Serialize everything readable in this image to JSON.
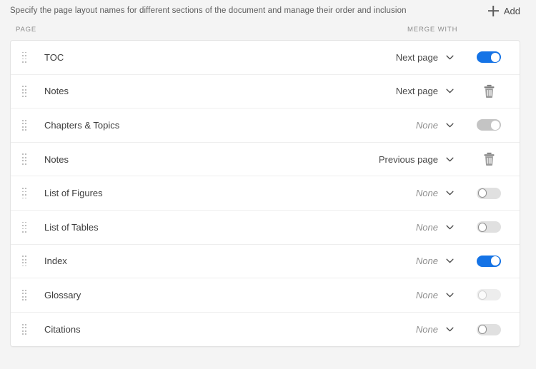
{
  "header": {
    "description": "Specify the page layout names for different sections of the document and manage their order and inclusion",
    "add_label": "Add",
    "add_icon": "plus-icon"
  },
  "table": {
    "columns": {
      "page": "PAGE",
      "merge_with": "MERGE WITH"
    },
    "rows": [
      {
        "name": "TOC",
        "merge_with": "Next page",
        "merge_is_none": false,
        "action": "toggle",
        "toggle_state": "on",
        "drag_handle_icon": "drag-handle-icon",
        "chevron_icon": "chevron-down-icon"
      },
      {
        "name": "Notes",
        "merge_with": "Next page",
        "merge_is_none": false,
        "action": "delete",
        "toggle_state": null,
        "drag_handle_icon": "drag-handle-icon",
        "chevron_icon": "chevron-down-icon"
      },
      {
        "name": "Chapters & Topics",
        "merge_with": "None",
        "merge_is_none": true,
        "action": "toggle",
        "toggle_state": "on-disabled",
        "drag_handle_icon": "drag-handle-icon",
        "chevron_icon": "chevron-down-icon"
      },
      {
        "name": "Notes",
        "merge_with": "Previous page",
        "merge_is_none": false,
        "action": "delete",
        "toggle_state": null,
        "drag_handle_icon": "drag-handle-icon",
        "chevron_icon": "chevron-down-icon"
      },
      {
        "name": "List of Figures",
        "merge_with": "None",
        "merge_is_none": true,
        "action": "toggle",
        "toggle_state": "off",
        "drag_handle_icon": "drag-handle-icon",
        "chevron_icon": "chevron-down-icon"
      },
      {
        "name": "List of Tables",
        "merge_with": "None",
        "merge_is_none": true,
        "action": "toggle",
        "toggle_state": "off",
        "drag_handle_icon": "drag-handle-icon",
        "chevron_icon": "chevron-down-icon"
      },
      {
        "name": "Index",
        "merge_with": "None",
        "merge_is_none": true,
        "action": "toggle",
        "toggle_state": "on",
        "drag_handle_icon": "drag-handle-icon",
        "chevron_icon": "chevron-down-icon"
      },
      {
        "name": "Glossary",
        "merge_with": "None",
        "merge_is_none": true,
        "action": "toggle",
        "toggle_state": "off-disabled",
        "drag_handle_icon": "drag-handle-icon",
        "chevron_icon": "chevron-down-icon"
      },
      {
        "name": "Citations",
        "merge_with": "None",
        "merge_is_none": true,
        "action": "toggle",
        "toggle_state": "off",
        "drag_handle_icon": "drag-handle-icon",
        "chevron_icon": "chevron-down-icon"
      }
    ]
  },
  "colors": {
    "accent": "#1473e6",
    "page_background": "#f4f4f4",
    "card_background": "#ffffff",
    "row_divider": "#eeeeee",
    "muted_text": "#909090",
    "toggle_off_track": "#e0e0e0",
    "toggle_disabled_track": "#c4c4c4"
  }
}
